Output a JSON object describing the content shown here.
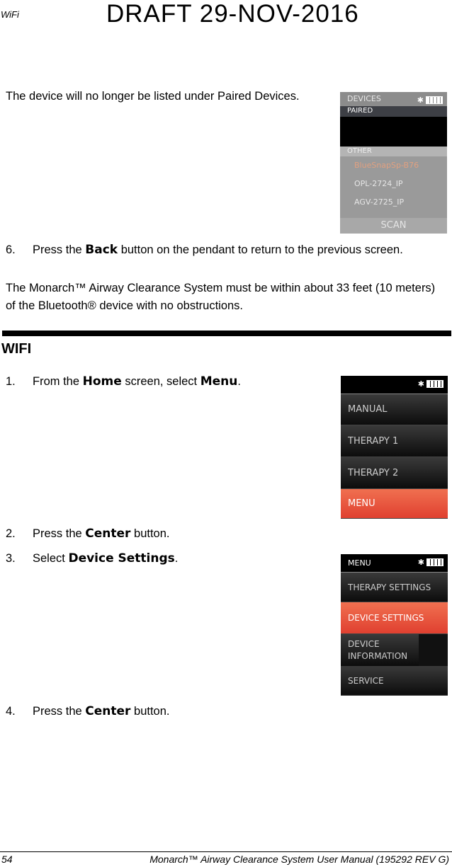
{
  "header": {
    "section": "WiFi",
    "draft": "DRAFT 29-NOV-2016"
  },
  "intro": {
    "text": "The device will no longer be listed under Paired Devices."
  },
  "step6": {
    "num": "6.",
    "pre": "Press the ",
    "bold": "Back",
    "post": " button on the pendant to return to the previous screen."
  },
  "note": "The Monarch™ Airway Clearance System must be within about 33 feet (10 meters) of the Bluetooth® device with no obstructions.",
  "wifi_heading": "WIFI",
  "steps": [
    {
      "num": "1.",
      "pre": "From the ",
      "bold": "Home",
      "mid": " screen, select ",
      "bold2": "Menu",
      "post": "."
    },
    {
      "num": "2.",
      "pre": "Press the ",
      "bold": "Center",
      "post": " button."
    },
    {
      "num": "3.",
      "pre": "Select ",
      "bold": "Device Settings",
      "post": "."
    },
    {
      "num": "4.",
      "pre": "Press the ",
      "bold": "Center",
      "post": " button."
    }
  ],
  "screen_devices": {
    "title": "DEVICES",
    "paired": "PAIRED",
    "other": "OTHER",
    "items": [
      "BlueSnapSp-B76",
      "OPL-2724_IP",
      "AGV-2725_IP"
    ],
    "scan": "SCAN",
    "highlight_color": "#e0a080",
    "icons": [
      "bluetooth-icon",
      "battery-icon"
    ]
  },
  "screen_home": {
    "title": "",
    "items": [
      "MANUAL",
      "THERAPY 1",
      "THERAPY 2",
      "MENU"
    ],
    "selected": "MENU"
  },
  "screen_menu": {
    "title": "MENU",
    "items": [
      "THERAPY SETTINGS",
      "DEVICE SETTINGS",
      "DEVICE INFORMATION",
      "SERVICE"
    ],
    "selected": "DEVICE SETTINGS",
    "accent": "#e5503a"
  },
  "footer": {
    "page": "54",
    "title": "Monarch™ Airway Clearance System User Manual (195292 REV G)"
  }
}
